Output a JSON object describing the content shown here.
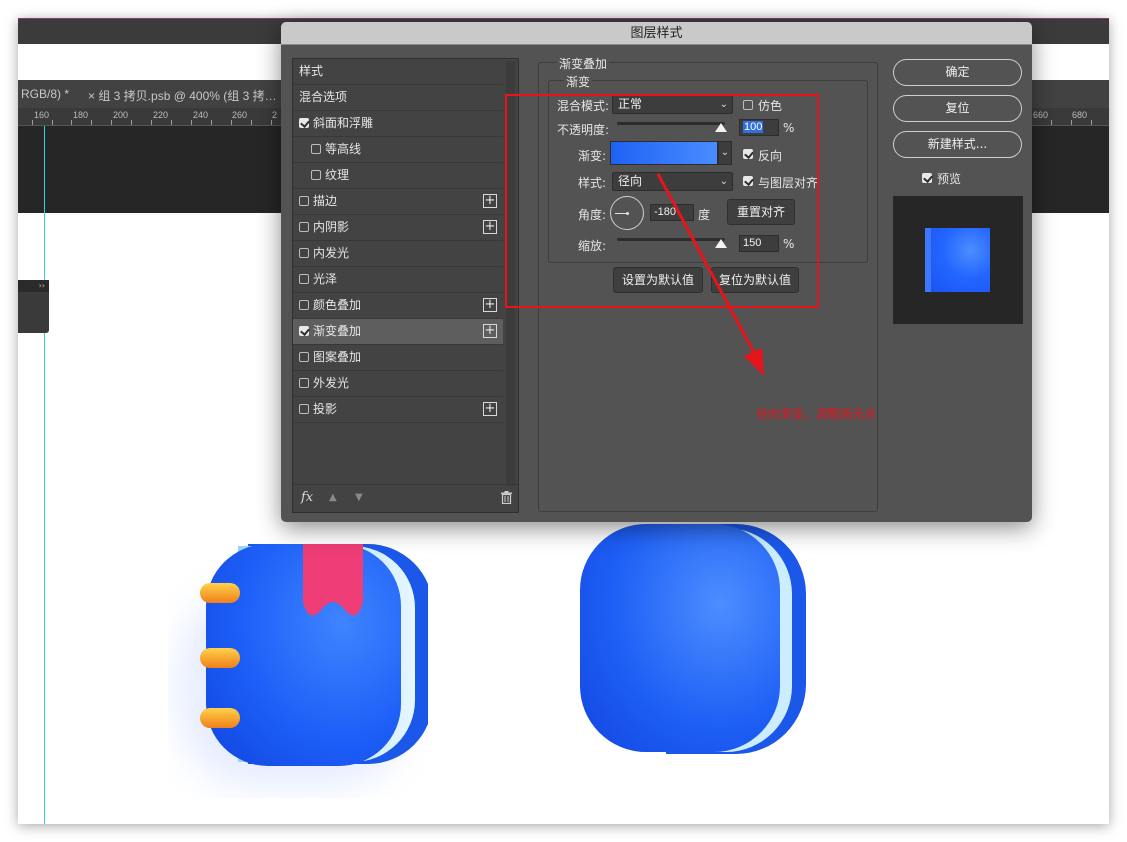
{
  "background": {
    "tab_left": "RGB/8) *",
    "tab_main": "×  组 3 拷贝.psb @ 400% (组 3 拷…",
    "ruler_left": [
      "160",
      "180",
      "200",
      "220",
      "240",
      "260",
      "2"
    ],
    "ruler_right": [
      "660",
      "680"
    ],
    "mini_panel_label": "››"
  },
  "dialog": {
    "title": "图层样式",
    "styles": [
      {
        "label": "样式",
        "checkbox": false,
        "plus": false,
        "indent": false,
        "header": true
      },
      {
        "label": "混合选项",
        "checkbox": false,
        "plus": false,
        "indent": false,
        "header": true
      },
      {
        "label": "斜面和浮雕",
        "checkbox": true,
        "checked": true,
        "plus": false,
        "indent": false
      },
      {
        "label": "等高线",
        "checkbox": true,
        "checked": false,
        "plus": false,
        "indent": true
      },
      {
        "label": "纹理",
        "checkbox": true,
        "checked": false,
        "plus": false,
        "indent": true
      },
      {
        "label": "描边",
        "checkbox": true,
        "checked": false,
        "plus": true,
        "indent": false
      },
      {
        "label": "内阴影",
        "checkbox": true,
        "checked": false,
        "plus": true,
        "indent": false
      },
      {
        "label": "内发光",
        "checkbox": true,
        "checked": false,
        "plus": false,
        "indent": false
      },
      {
        "label": "光泽",
        "checkbox": true,
        "checked": false,
        "plus": false,
        "indent": false
      },
      {
        "label": "颜色叠加",
        "checkbox": true,
        "checked": false,
        "plus": true,
        "indent": false
      },
      {
        "label": "渐变叠加",
        "checkbox": true,
        "checked": true,
        "plus": true,
        "indent": false,
        "selected": true
      },
      {
        "label": "图案叠加",
        "checkbox": true,
        "checked": false,
        "plus": false,
        "indent": false
      },
      {
        "label": "外发光",
        "checkbox": true,
        "checked": false,
        "plus": false,
        "indent": false
      },
      {
        "label": "投影",
        "checkbox": true,
        "checked": false,
        "plus": true,
        "indent": false
      }
    ],
    "footer_fx": "fx",
    "section_title": "渐变叠加",
    "sub_title": "渐变",
    "blend_mode_label": "混合模式:",
    "blend_mode_value": "正常",
    "dither_label": "仿色",
    "dither_checked": false,
    "opacity_label": "不透明度:",
    "opacity_value": "100",
    "opacity_percent": 100,
    "opacity_unit": "%",
    "gradient_label": "渐变:",
    "reverse_label": "反向",
    "reverse_checked": true,
    "style_label": "样式:",
    "style_value": "径向",
    "align_label": "与图层对齐",
    "align_checked": true,
    "angle_label": "角度:",
    "angle_value": "-180",
    "angle_unit": "度",
    "reset_align_button": "重置对齐",
    "scale_label": "缩放:",
    "scale_value": "150",
    "scale_percent": 150,
    "scale_unit": "%",
    "set_default_button": "设置为默认值",
    "reset_default_button": "复位为默认值",
    "ok_button": "确定",
    "reset_button": "复位",
    "new_style_button": "新建样式...",
    "preview_label": "预览",
    "preview_checked": true
  },
  "annotation": {
    "text": "径向渐变，调整高光点",
    "color": "#e8141b"
  },
  "colors": {
    "accent_blue": "#2366ff",
    "gradient_start": "#1e62f5",
    "gradient_end": "#4a8cff"
  }
}
